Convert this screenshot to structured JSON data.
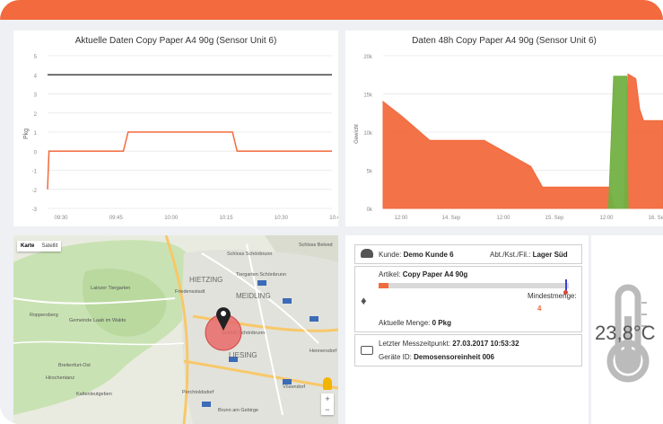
{
  "chart_current": {
    "title": "Aktuelle Daten Copy Paper A4 90g (Sensor Unit 6)",
    "ylabel": "Pkg",
    "chart_data": {
      "type": "line",
      "title": "Aktuelle Daten Copy Paper A4 90g (Sensor Unit 6)",
      "ylabel": "Pkg",
      "ylim": [
        -3,
        5
      ],
      "yticks": [
        "5",
        "4",
        "3",
        "2",
        "1",
        "0",
        "-1",
        "-2",
        "-3"
      ],
      "xticks": [
        "09:30",
        "09:45",
        "10:00",
        "10:15",
        "10:30",
        "10:45"
      ],
      "series": [
        {
          "color": "#f26a3d",
          "points": [
            [
              0,
              -2
            ],
            [
              0.3,
              0
            ],
            [
              16,
              0
            ],
            [
              17,
              1
            ],
            [
              39,
              1
            ],
            [
              40,
              0
            ],
            [
              60,
              0
            ]
          ]
        },
        {
          "color": "#444444",
          "points": [
            [
              0,
              4
            ],
            [
              60,
              4
            ]
          ]
        }
      ],
      "grid": true
    }
  },
  "chart_48h": {
    "title": "Daten 48h Copy Paper A4 90g (Sensor Unit 6)",
    "ylabel": "Gewicht",
    "chart_data": {
      "type": "area",
      "title": "Daten 48h Copy Paper A4 90g (Sensor Unit 6)",
      "ylabel": "Gewicht",
      "ylim": [
        0,
        20000
      ],
      "yticks": [
        "20k",
        "15k",
        "10k",
        "5k",
        "0k"
      ],
      "xticks": [
        "12:00",
        "14. Sep",
        "12:00",
        "15. Sep",
        "12:00",
        "16. Sep"
      ],
      "series": [
        {
          "name": "",
          "color": "#f26a3d",
          "points": [
            [
              0,
              14000
            ],
            [
              5,
              12000
            ],
            [
              12,
              8900
            ],
            [
              26,
              8900
            ],
            [
              38,
              5500
            ],
            [
              41,
              2800
            ],
            [
              58,
              2800
            ],
            [
              59.5,
              0
            ],
            [
              62,
              0
            ],
            [
              63,
              17600
            ],
            [
              65,
              17000
            ],
            [
              66,
              13000
            ],
            [
              67,
              11500
            ],
            [
              72,
              11500
            ]
          ]
        },
        {
          "name": "",
          "color": "#72b042",
          "points": [
            [
              58,
              0
            ],
            [
              59.3,
              17300
            ],
            [
              62.7,
              17300
            ],
            [
              63,
              0
            ]
          ]
        }
      ],
      "grid": true
    }
  },
  "map": {
    "tab_map": "Karte",
    "tab_satellite": "Satellit",
    "zoom_in": "+",
    "zoom_out": "−",
    "places": [
      "Schloss Schönbrunn",
      "Tiergarten Schönbrunn",
      "HIETZING",
      "MEIDLING",
      "Lainzer Tiergarten",
      "Roppersberg",
      "Gemeinde Laab im Walde",
      "LIESING",
      "Breitenfurt-Ost",
      "Hirschentanz",
      "Perchtoldsdorf",
      "Kaltenleutgeben",
      "Vösendorf",
      "Brunn am Gebirge",
      "Schloss Belved",
      "Hennersdorf",
      "Friedensstadt",
      "Schloß Schönbrunn"
    ]
  },
  "info": {
    "customer_label": "Kunde:",
    "customer_value": "Demo Kunde 6",
    "dept_label": "Abt./Kst./Fil.:",
    "dept_value": "Lager Süd",
    "article_label": "Artikel:",
    "article_value": "Copy Paper A4 90g",
    "min_label": "Mindestmenge:",
    "min_value": "4",
    "fill_level": 0.05,
    "current_label": "Aktuelle Menge:",
    "current_value": "0 Pkg",
    "last_label": "Letzter Messzeitpunkt:",
    "last_value": "27.03.2017 10:53:32",
    "device_label": "Geräte ID:",
    "device_value": "Demosensoreinheit 006"
  },
  "temperature": {
    "value": "23,8°C"
  },
  "colors": {
    "accent": "#f26a3d",
    "green": "#72b042",
    "min_marker": "#3b3fd6"
  }
}
